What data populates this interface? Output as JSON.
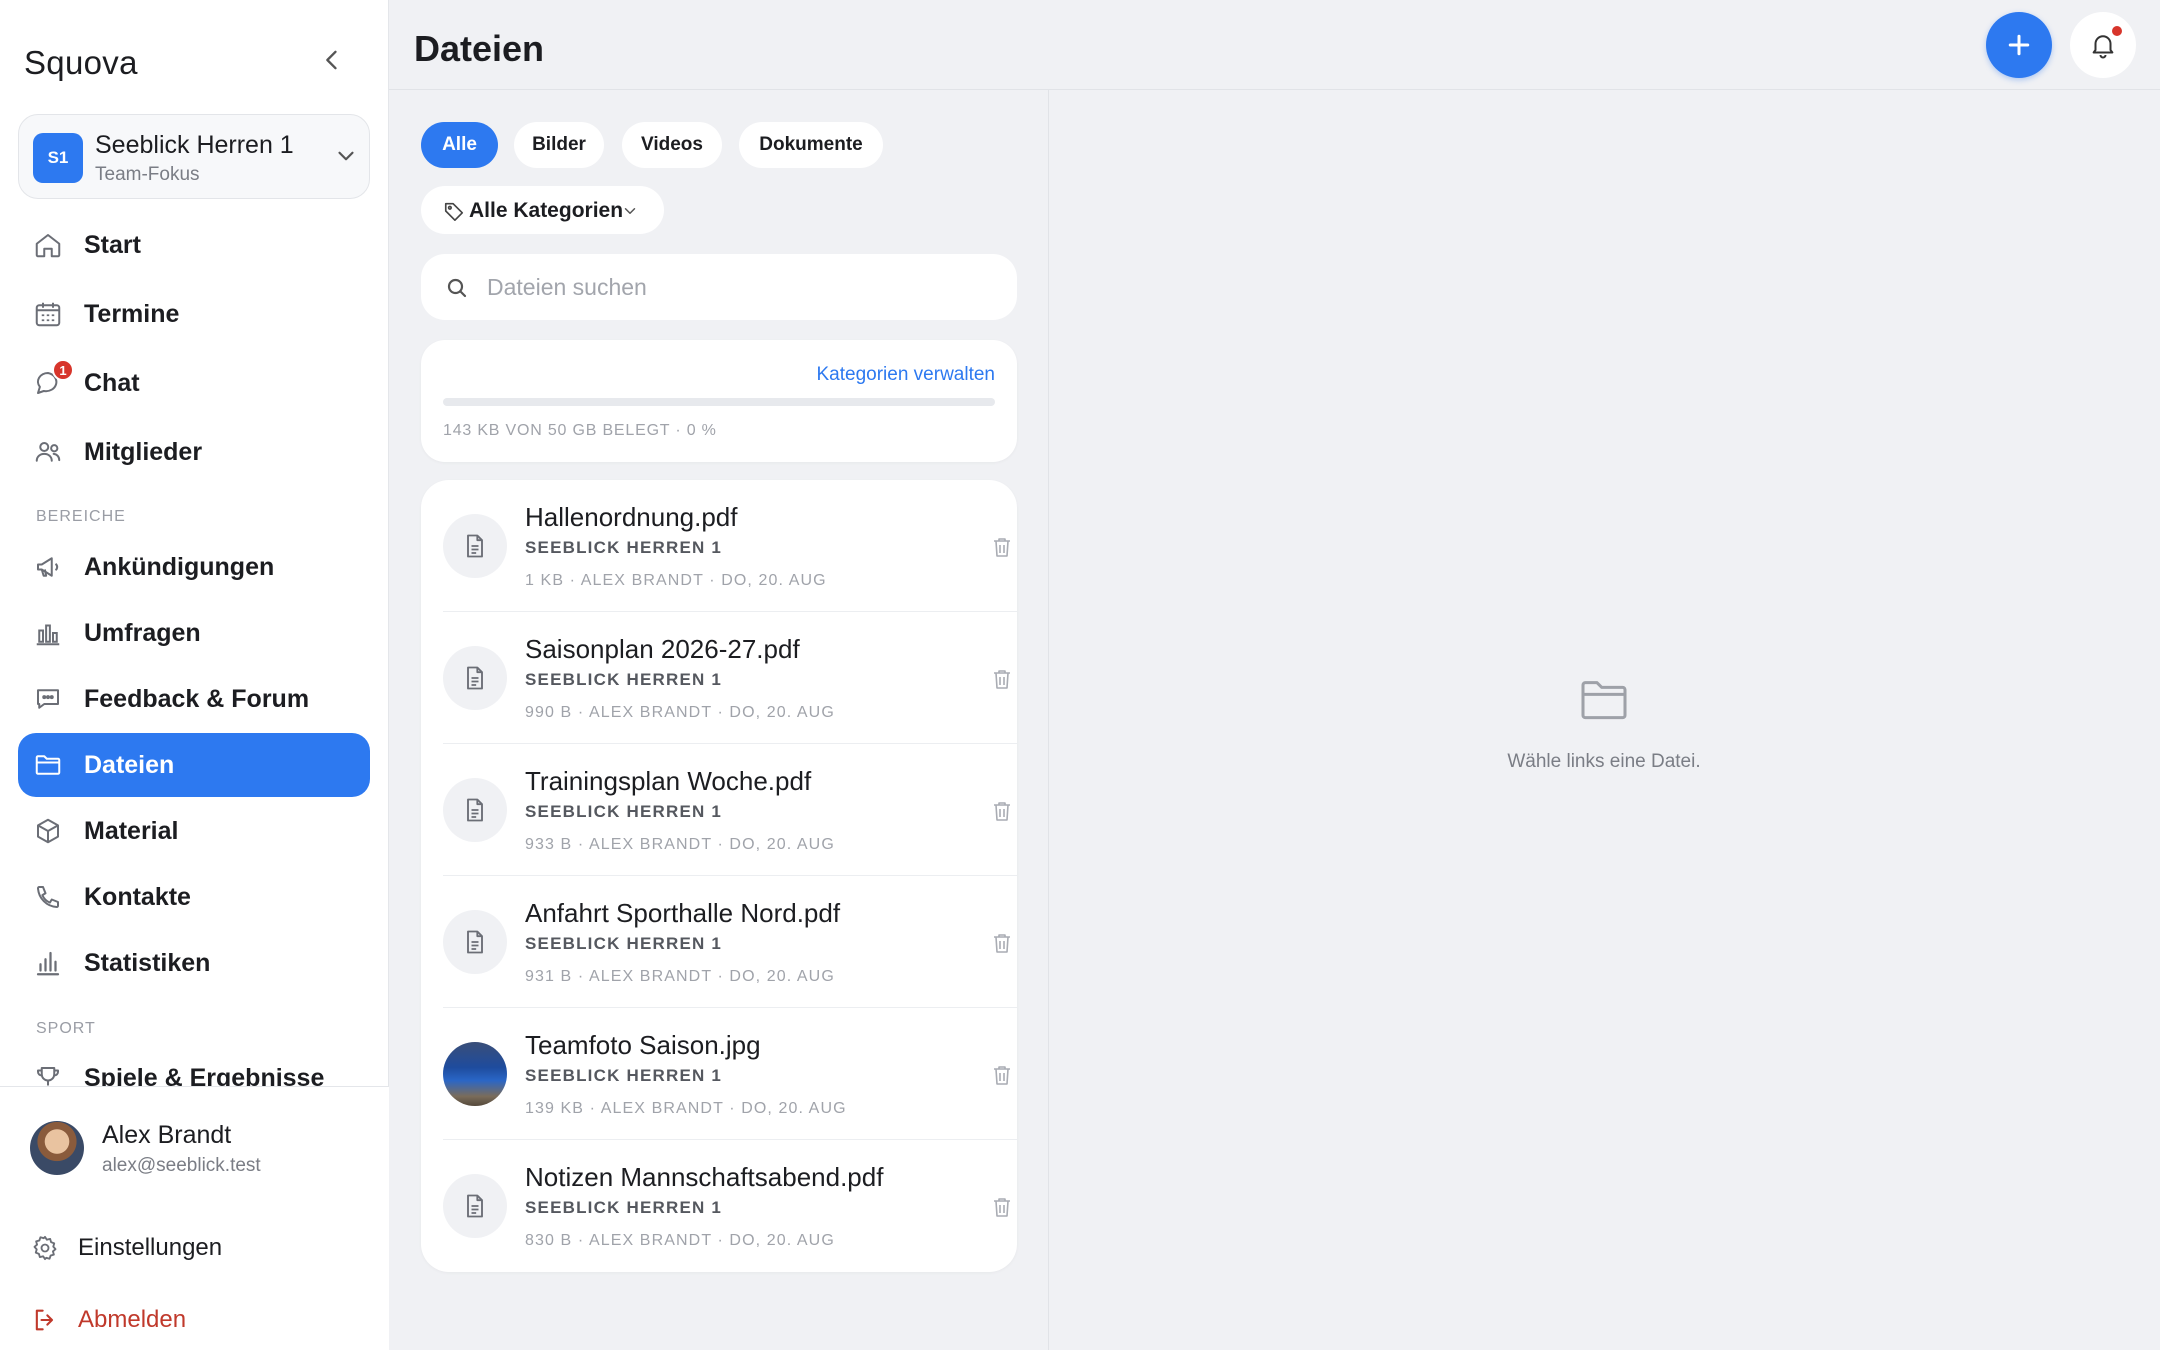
{
  "app": {
    "brand": "Squova"
  },
  "team": {
    "initials": "S1",
    "name": "Seeblick Herren 1",
    "subtitle": "Team-Fokus"
  },
  "nav": {
    "main": [
      {
        "label": "Start",
        "icon": "home-icon"
      },
      {
        "label": "Termine",
        "icon": "calendar-icon"
      },
      {
        "label": "Chat",
        "icon": "chat-icon",
        "badge": "1"
      },
      {
        "label": "Mitglieder",
        "icon": "members-icon"
      }
    ],
    "section_bereiche": "BEREICHE",
    "bereiche": [
      {
        "label": "Ankündigungen",
        "icon": "megaphone-icon"
      },
      {
        "label": "Umfragen",
        "icon": "poll-chart-icon"
      },
      {
        "label": "Feedback & Forum",
        "icon": "forum-icon"
      },
      {
        "label": "Dateien",
        "icon": "folder-icon",
        "active": true
      },
      {
        "label": "Material",
        "icon": "box-icon"
      },
      {
        "label": "Kontakte",
        "icon": "phone-icon"
      },
      {
        "label": "Statistiken",
        "icon": "stats-icon"
      }
    ],
    "section_sport": "SPORT",
    "sport": [
      {
        "label": "Spiele & Ergebnisse",
        "icon": "trophy-icon"
      }
    ]
  },
  "user": {
    "name": "Alex Brandt",
    "email": "alex@seeblick.test"
  },
  "bottom": {
    "settings": "Einstellungen",
    "logout": "Abmelden"
  },
  "header": {
    "title": "Dateien"
  },
  "filters": {
    "chips": [
      "Alle",
      "Bilder",
      "Videos",
      "Dokumente"
    ],
    "active_chip": "Alle",
    "category": "Alle Kategorien"
  },
  "search": {
    "placeholder": "Dateien suchen"
  },
  "storage": {
    "manage_label": "Kategorien verwalten",
    "info": "143 KB VON 50 GB BELEGT · 0 %",
    "used_percent": 0
  },
  "files": [
    {
      "name": "Hallenordnung.pdf",
      "team": "SEEBLICK HERREN 1",
      "meta": "1 KB · ALEX BRANDT · DO, 20. AUG",
      "type": "document"
    },
    {
      "name": "Saisonplan 2026-27.pdf",
      "team": "SEEBLICK HERREN 1",
      "meta": "990 B · ALEX BRANDT · DO, 20. AUG",
      "type": "document"
    },
    {
      "name": "Trainingsplan Woche.pdf",
      "team": "SEEBLICK HERREN 1",
      "meta": "933 B · ALEX BRANDT · DO, 20. AUG",
      "type": "document"
    },
    {
      "name": "Anfahrt Sporthalle Nord.pdf",
      "team": "SEEBLICK HERREN 1",
      "meta": "931 B · ALEX BRANDT · DO, 20. AUG",
      "type": "document"
    },
    {
      "name": "Teamfoto Saison.jpg",
      "team": "SEEBLICK HERREN 1",
      "meta": "139 KB · ALEX BRANDT · DO, 20. AUG",
      "type": "image"
    },
    {
      "name": "Notizen Mannschaftsabend.pdf",
      "team": "SEEBLICK HERREN 1",
      "meta": "830 B · ALEX BRANDT · DO, 20. AUG",
      "type": "document"
    }
  ],
  "empty_state": {
    "text": "Wähle links eine Datei."
  },
  "colors": {
    "accent": "#2d79f0",
    "danger": "#c0392b",
    "badge": "#d7352b"
  }
}
